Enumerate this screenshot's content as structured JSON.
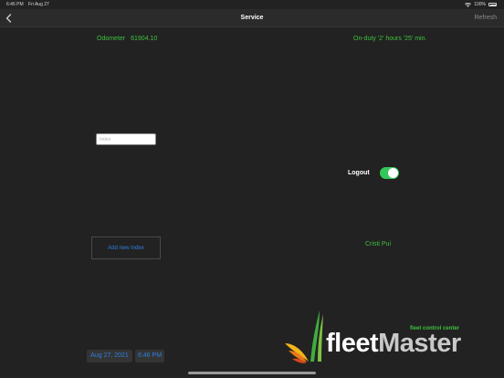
{
  "status_bar": {
    "time": "6:46 PM",
    "date": "Fri Aug 27",
    "battery": "100%"
  },
  "nav": {
    "title": "Service",
    "refresh_label": "Refresh"
  },
  "odometer": {
    "label": "Odometer",
    "value": "61904.10"
  },
  "on_duty": "On-duty '2' hours '25' min.",
  "index_input": {
    "placeholder": "Index",
    "value": ""
  },
  "logout": {
    "label": "Logout",
    "enabled": true
  },
  "add_index_label": "Add new Index",
  "driver_name": "Cristi Pui",
  "datetime": {
    "date": "Aug 27, 2021",
    "time": "6:46 PM"
  },
  "logo": {
    "tagline": "fleet control center",
    "word_fleet": "fleet",
    "word_master": "Master"
  },
  "colors": {
    "background": "#222222",
    "accent_green": "#3ec13e",
    "link_blue": "#2f7ee0",
    "toggle_on": "#34c759"
  },
  "icons": {
    "back": "chevron-left-icon",
    "wifi": "wifi-icon",
    "battery": "battery-icon"
  }
}
